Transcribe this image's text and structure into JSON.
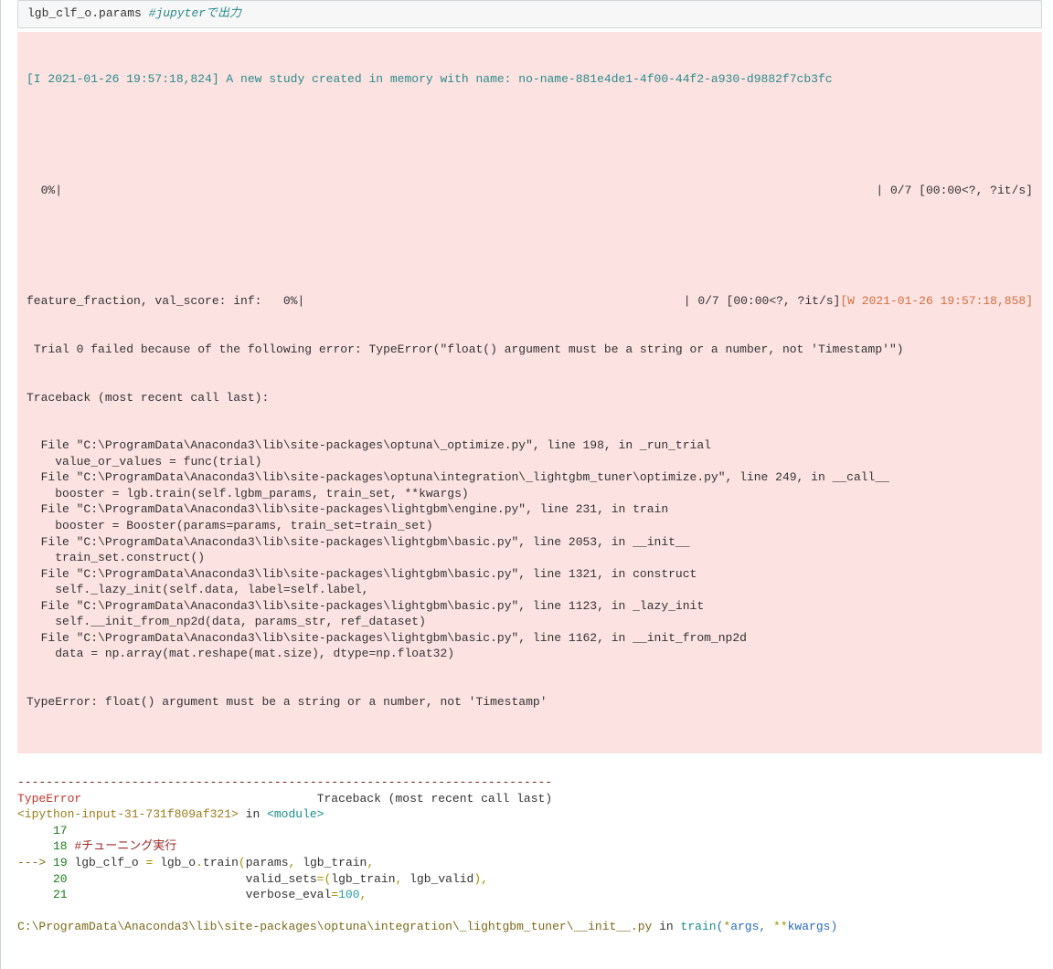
{
  "input_cell": {
    "code": "lgb_clf_o.params",
    "comment": "#jupyterで出力"
  },
  "stderr": {
    "info_line": "[I 2021-01-26 19:57:18,824] A new study created in memory with name: no-name-881e4de1-4f00-44f2-a930-d9882f7cb3fc",
    "progress1_left": "  0%|",
    "progress1_right": "| 0/7 [00:00<?, ?it/s]",
    "progress2_left": "feature_fraction, val_score: inf:   0%|",
    "progress2_right": "| 0/7 [00:00<?, ?it/s]",
    "warn_prefix": "[W 2021-01-26 19:57:18,858]",
    "warn_tail": " Trial 0 failed because of the following error: TypeError(\"float() argument must be a string or a number, not 'Timestamp'\")",
    "tb_header": "Traceback (most recent call last):",
    "frames": [
      {
        "loc": "  File \"C:\\ProgramData\\Anaconda3\\lib\\site-packages\\optuna\\_optimize.py\", line 198, in _run_trial",
        "src": "    value_or_values = func(trial)"
      },
      {
        "loc": "  File \"C:\\ProgramData\\Anaconda3\\lib\\site-packages\\optuna\\integration\\_lightgbm_tuner\\optimize.py\", line 249, in __call__",
        "src": "    booster = lgb.train(self.lgbm_params, train_set, **kwargs)"
      },
      {
        "loc": "  File \"C:\\ProgramData\\Anaconda3\\lib\\site-packages\\lightgbm\\engine.py\", line 231, in train",
        "src": "    booster = Booster(params=params, train_set=train_set)"
      },
      {
        "loc": "  File \"C:\\ProgramData\\Anaconda3\\lib\\site-packages\\lightgbm\\basic.py\", line 2053, in __init__",
        "src": "    train_set.construct()"
      },
      {
        "loc": "  File \"C:\\ProgramData\\Anaconda3\\lib\\site-packages\\lightgbm\\basic.py\", line 1321, in construct",
        "src": "    self._lazy_init(self.data, label=self.label,"
      },
      {
        "loc": "  File \"C:\\ProgramData\\Anaconda3\\lib\\site-packages\\lightgbm\\basic.py\", line 1123, in _lazy_init",
        "src": "    self.__init_from_np2d(data, params_str, ref_dataset)"
      },
      {
        "loc": "  File \"C:\\ProgramData\\Anaconda3\\lib\\site-packages\\lightgbm\\basic.py\", line 1162, in __init_from_np2d",
        "src": "    data = np.array(mat.reshape(mat.size), dtype=np.float32)"
      }
    ],
    "final_err": "TypeError: float() argument must be a string or a number, not 'Timestamp'"
  },
  "ipython_tb": {
    "separator": "---------------------------------------------------------------------------",
    "err_name": "TypeError",
    "tb_label": "Traceback (most recent call last)",
    "module_line_left": "<ipython-input-31-731f809af321>",
    "module_line_in": " in ",
    "module_line_right": "<module>",
    "lines": {
      "l17_no": "     17",
      "l17_txt": " ",
      "l18_no": "     18",
      "l18_txt": " #チューニング実行",
      "arrow": "---> ",
      "l19_no": "19",
      "l19_a": " lgb_clf_o ",
      "l19_eq": "=",
      "l19_b": " lgb_o",
      "l19_dot": ".",
      "l19_fn": "train",
      "l19_p1": "(",
      "l19_arg1": "params",
      "l19_c1": ",",
      "l19_arg2": " lgb_train",
      "l19_c2": ",",
      "l20_no": "     20",
      "l20_pad": "                         ",
      "l20_kw": "valid_sets",
      "l20_eq": "=",
      "l20_p1": "(",
      "l20_a1": "lgb_train",
      "l20_c1": ",",
      "l20_a2": " lgb_valid",
      "l20_p2": ")",
      "l20_c2": ",",
      "l21_no": "     21",
      "l21_pad": "                         ",
      "l21_kw": "verbose_eval",
      "l21_eq": "=",
      "l21_val": "100",
      "l21_c": ","
    },
    "file_line": {
      "path": "C:\\ProgramData\\Anaconda3\\lib\\site-packages\\optuna\\integration\\_lightgbm_tuner\\__init__.py",
      "in": " in ",
      "fn": "train",
      "p1": "(",
      "star": "*",
      "a1": "args",
      "c": ", ",
      "dstar": "**",
      "a2": "kwargs",
      "p2": ")"
    }
  }
}
